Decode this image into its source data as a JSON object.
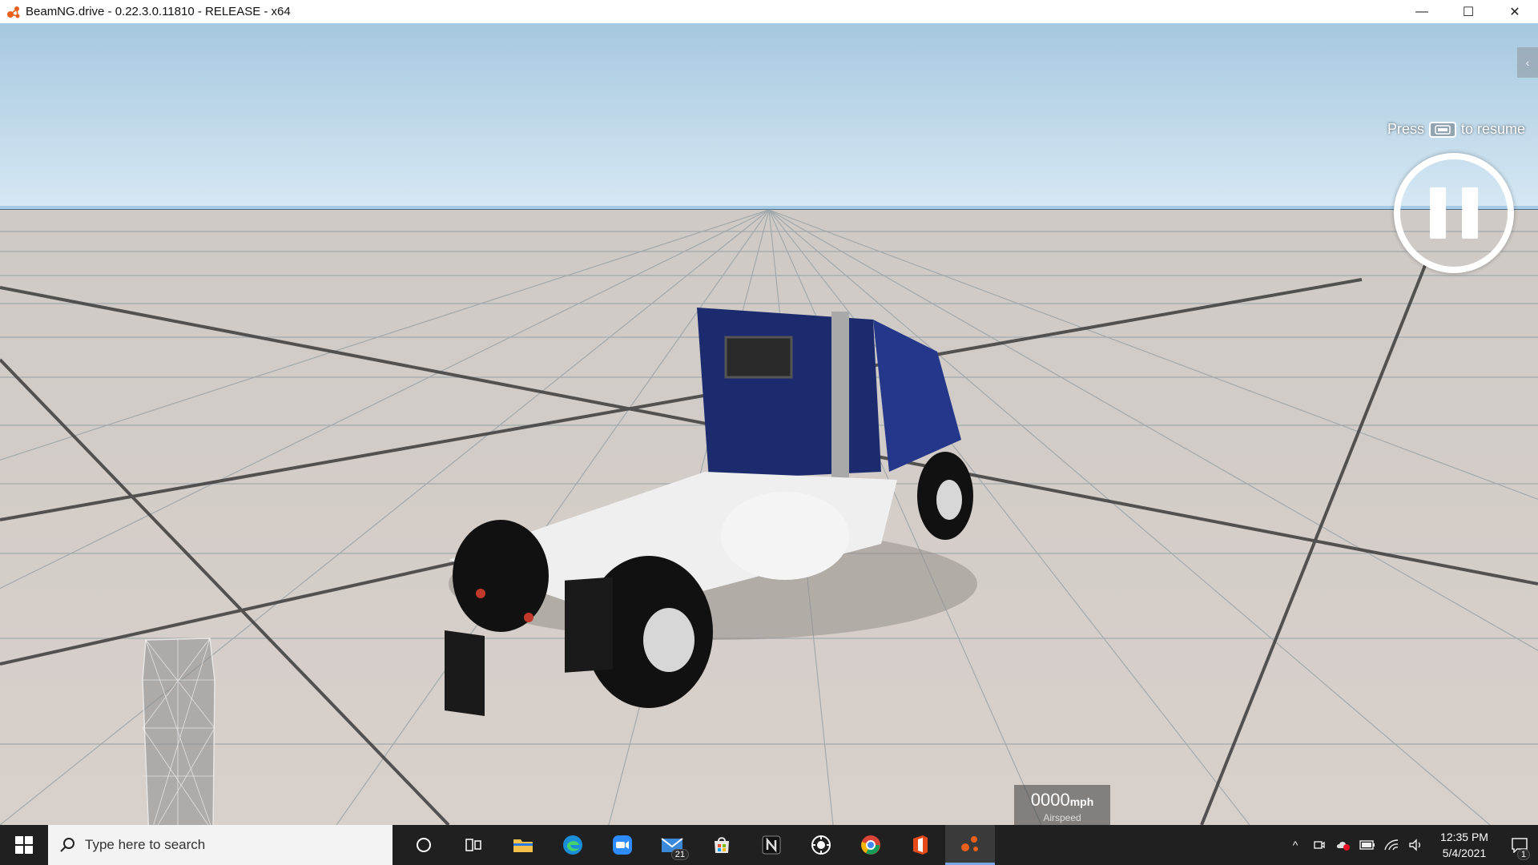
{
  "window": {
    "title": "BeamNG.drive - 0.22.3.0.11810 - RELEASE - x64",
    "minimize": "—",
    "maximize": "☐",
    "close": "✕",
    "accent": "#e8601c"
  },
  "game": {
    "resume_prefix": "Press",
    "resume_suffix": "to resume",
    "side_toggle": "‹",
    "speedo": {
      "value": "0000",
      "unit": "mph",
      "label": "Airspeed"
    },
    "truck_color": "#1c2b6e"
  },
  "taskbar": {
    "search_placeholder": "Type here to search",
    "apps": [
      {
        "name": "cortana-icon"
      },
      {
        "name": "task-view-icon"
      },
      {
        "name": "file-explorer-icon"
      },
      {
        "name": "edge-icon"
      },
      {
        "name": "zoom-icon"
      },
      {
        "name": "mail-icon",
        "badge": "21"
      },
      {
        "name": "store-icon"
      },
      {
        "name": "notion-icon"
      },
      {
        "name": "steam-icon"
      },
      {
        "name": "chrome-icon"
      },
      {
        "name": "office-icon"
      },
      {
        "name": "beamng-icon",
        "active": true
      }
    ],
    "clock": {
      "time": "12:35 PM",
      "date": "5/4/2021"
    },
    "notification_count": "1"
  }
}
